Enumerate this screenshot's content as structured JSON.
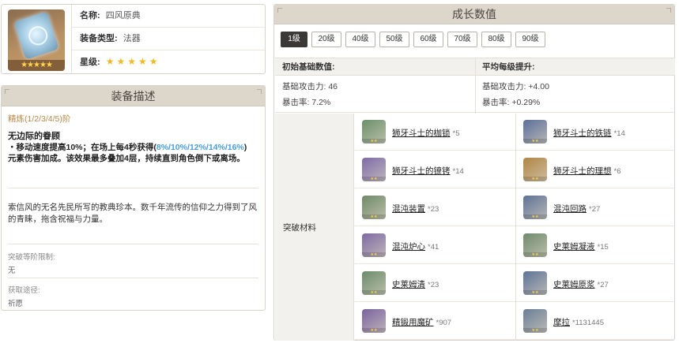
{
  "weapon": {
    "name_label": "名称:",
    "name": "四风原典",
    "type_label": "装备类型:",
    "type": "法器",
    "rarity_label": "星级:",
    "rarity_stars": "★★★★★",
    "image_stars": "★★★★★"
  },
  "description": {
    "title": "装备描述",
    "refine": "精炼(1/2/3/4/5)阶",
    "passive_name": "无边际的眷顾",
    "passive_line1_pre": "・移动速度提高10%；在场上每4秒获得(",
    "passive_line1_values": "8%/10%/12%/14%/16%",
    "passive_line1_post": ")",
    "passive_line2": "元素伤害加成。该效果最多叠加4层，持续直到角色倒下或离场。",
    "lore": "索信风的无名先民所写的教典珍本。数千年流传的信仰之力得到了风的青睐，拖含祝福与力量。",
    "ascension_limit_label": "突破等阶限制:",
    "ascension_limit_value": "无",
    "source_label": "获取途径:",
    "source_value": "祈愿"
  },
  "growth": {
    "title": "成长数值",
    "levels": [
      "1级",
      "20级",
      "40级",
      "50级",
      "60级",
      "70级",
      "80级",
      "90级"
    ],
    "active_level": "1级",
    "base_header": "初始基础数值:",
    "avg_header": "平均每级提升:",
    "base_atk": "基础攻击力: 46",
    "base_crit": "暴击率: 7.2%",
    "avg_atk": "基础攻击力: +4.00",
    "avg_crit": "暴击率: +0.29%",
    "materials_label": "突破材料",
    "materials": [
      {
        "name": "狮牙斗士的枷锁",
        "count": "*5",
        "icon": "fetters-icon",
        "color": "#6b8f6a"
      },
      {
        "name": "狮牙斗士的铁链",
        "count": "*14",
        "icon": "iron-chain-icon",
        "color": "#5b6f9a"
      },
      {
        "name": "狮牙斗士的镣铐",
        "count": "*14",
        "icon": "shackles-icon",
        "color": "#7c6ba8"
      },
      {
        "name": "狮牙斗士的理想",
        "count": "*6",
        "icon": "dream-icon",
        "color": "#b08545"
      },
      {
        "name": "混沌装置",
        "count": "*23",
        "icon": "chaos-device-icon",
        "color": "#6e8a68"
      },
      {
        "name": "混沌回路",
        "count": "*27",
        "icon": "chaos-circuit-icon",
        "color": "#5e7296"
      },
      {
        "name": "混沌炉心",
        "count": "*41",
        "icon": "chaos-core-icon",
        "color": "#7d6aa3"
      },
      {
        "name": "史莱姆凝液",
        "count": "*15",
        "icon": "slime-condensate-icon",
        "color": "#6f8a6e"
      },
      {
        "name": "史莱姆清",
        "count": "*23",
        "icon": "slime-secretions-icon",
        "color": "#6b8c6a"
      },
      {
        "name": "史莱姆原浆",
        "count": "*27",
        "icon": "slime-concentrate-icon",
        "color": "#5e7396"
      },
      {
        "name": "精锻用魔矿",
        "count": "*907",
        "icon": "mystic-ore-icon",
        "color": "#7a62a0"
      },
      {
        "name": "摩拉",
        "count": "*1131445",
        "icon": "mora-icon",
        "color": "#6a7e96"
      }
    ]
  }
}
